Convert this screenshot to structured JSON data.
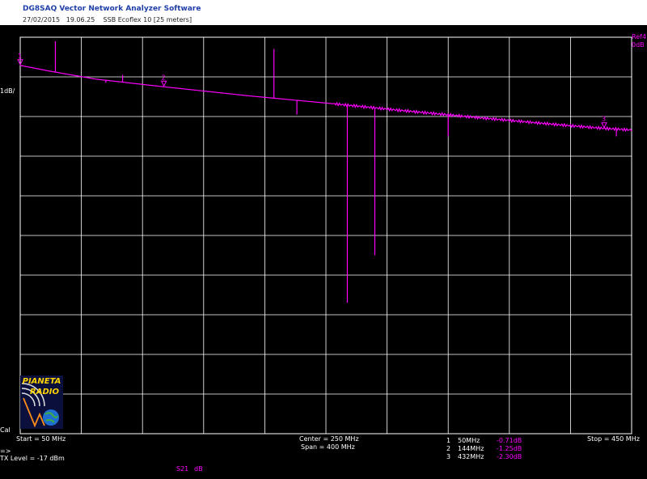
{
  "header": {
    "app_title": "DG8SAQ Vector Network Analyzer Software",
    "subtitle": "27/02/2015   19.06.25    SSB Ecoflex 10 [25 meters]"
  },
  "scale_label": "1dB/",
  "ref_label": "Ref4",
  "ref_value": "0dB",
  "cal_label": "Cal",
  "start_label": "Start = 50 MHz",
  "center_label": "Center = 250 MHz",
  "span_label": "Span = 400 MHz",
  "stop_label": "Stop = 450 MHz",
  "prompt": "=>",
  "tx_level": "TX Level = -17 dBm",
  "trace_label": "S21",
  "trace_unit": "dB",
  "logo": {
    "line1": "PIANETA",
    "line2": "RADIO"
  },
  "markers": [
    {
      "num": "1",
      "freq": "50MHz",
      "value": "-0.71dB"
    },
    {
      "num": "2",
      "freq": "144MHz",
      "value": "-1.25dB"
    },
    {
      "num": "3",
      "freq": "432MHz",
      "value": "-2.30dB"
    }
  ],
  "colors": {
    "trace": "#ff00ff",
    "grid": "#ffffff",
    "background": "#000000",
    "title": "#1f3fa8"
  },
  "chart_data": {
    "type": "line",
    "title": "SSB Ecoflex 10 [25 meters]",
    "xlabel": "",
    "ylabel": "",
    "x_unit": "MHz",
    "y_unit": "dB",
    "xlim": [
      50,
      450
    ],
    "ylim": [
      -10,
      0
    ],
    "grid": true,
    "series": [
      {
        "name": "S21",
        "x": [
          50,
          70,
          100,
          144,
          200,
          250,
          300,
          350,
          400,
          432,
          450
        ],
        "values": [
          -0.71,
          -0.86,
          -1.06,
          -1.25,
          -1.48,
          -1.66,
          -1.85,
          -2.03,
          -2.2,
          -2.3,
          -2.34
        ]
      }
    ],
    "spikes": [
      {
        "x": 73,
        "y": -0.1
      },
      {
        "x": 106,
        "y": -1.15
      },
      {
        "x": 117,
        "y": -0.95
      },
      {
        "x": 216,
        "y": -0.3
      },
      {
        "x": 231,
        "y": -1.95
      },
      {
        "x": 264,
        "y": -6.7
      },
      {
        "x": 282,
        "y": -5.5
      },
      {
        "x": 330,
        "y": -2.5
      },
      {
        "x": 440,
        "y": -2.5
      }
    ]
  }
}
